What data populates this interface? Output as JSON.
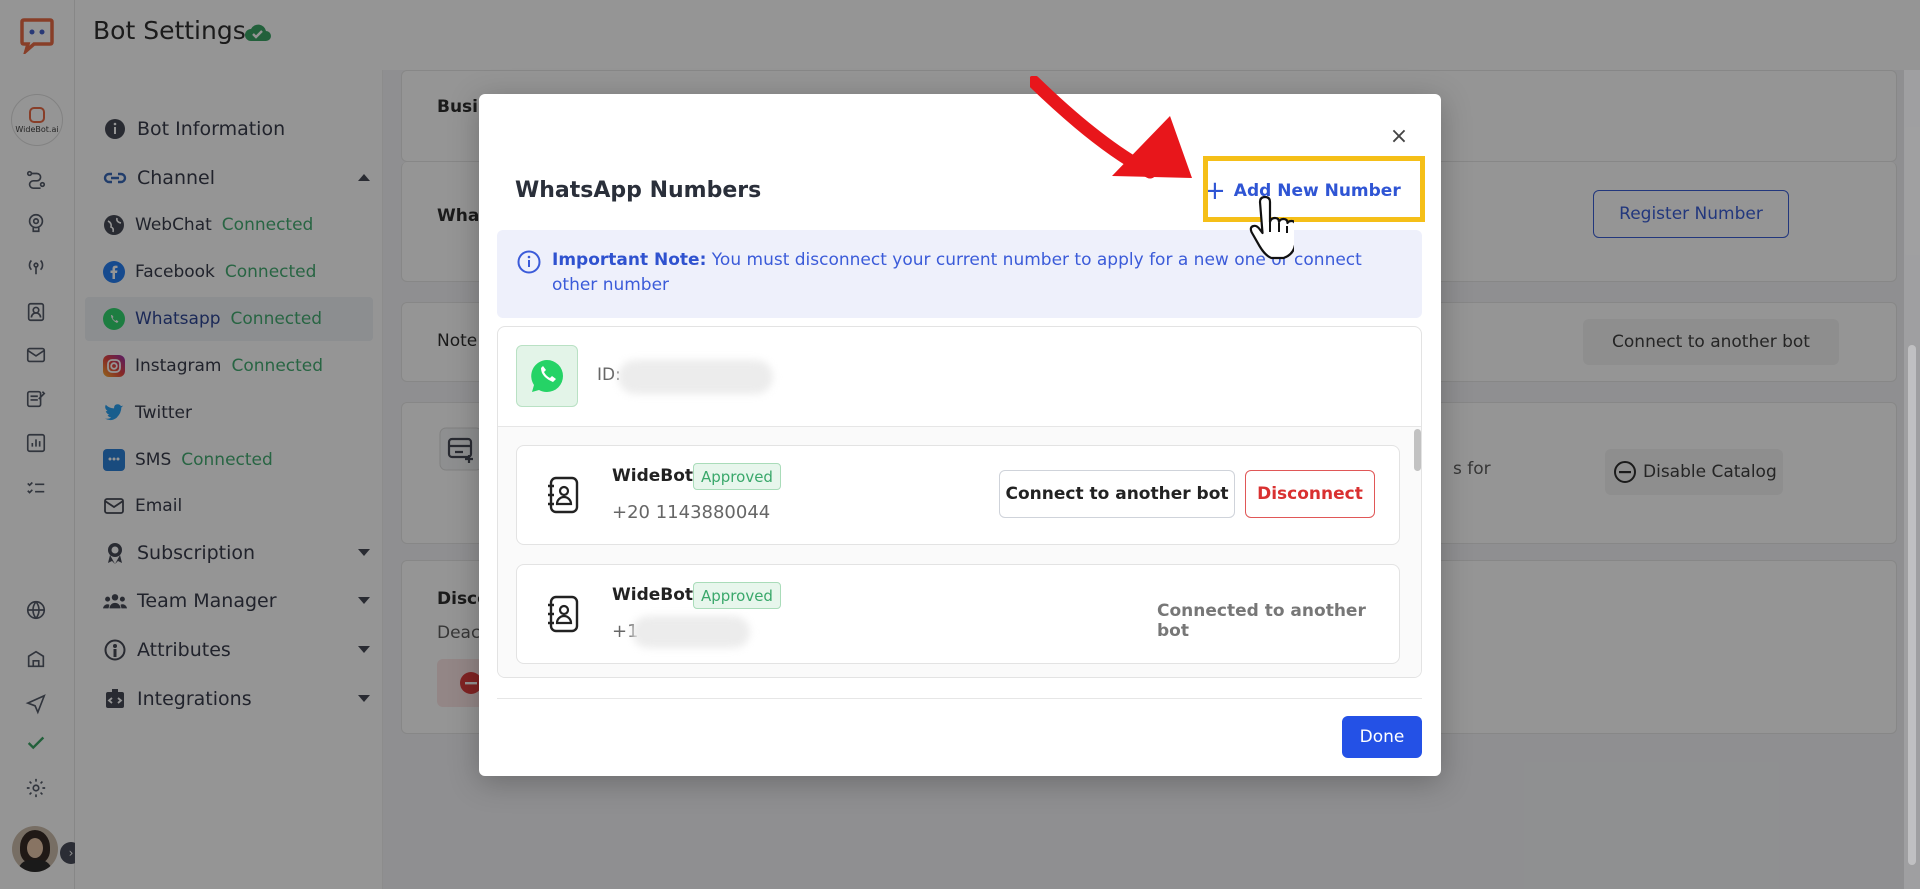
{
  "header": {
    "title": "Bot Settings"
  },
  "rail": {
    "workspace_label": "WideBot.ai"
  },
  "nav": {
    "bot_information": "Bot Information",
    "channel": "Channel",
    "channels": [
      {
        "label": "WebChat",
        "status": "Connected"
      },
      {
        "label": "Facebook",
        "status": "Connected"
      },
      {
        "label": "Whatsapp",
        "status": "Connected"
      },
      {
        "label": "Instagram",
        "status": "Connected"
      },
      {
        "label": "Twitter",
        "status": ""
      },
      {
        "label": "SMS",
        "status": "Connected"
      },
      {
        "label": "Email",
        "status": ""
      }
    ],
    "subscription": "Subscription",
    "team_manager": "Team Manager",
    "attributes": "Attributes",
    "integrations": "Integrations"
  },
  "background": {
    "business_label": "Busines",
    "whatsapp_label": "WhatsA",
    "register_number": "Register Number",
    "note_label": "Note: Yo",
    "connect_to_another_bot": "Connect to another bot",
    "catalog_text": "s for",
    "disable_catalog": "Disable Catalog",
    "disconnect_label": "Disconn",
    "deactivate_label": "Deactiv"
  },
  "modal": {
    "title": "WhatsApp Numbers",
    "add_new_number": "Add New Number",
    "close": "×",
    "note_title": "Important Note:",
    "note_text": "You must disconnect your current number to apply for a new one or connect other number",
    "id_label": "ID:",
    "accounts": [
      {
        "name": "WideBot",
        "badge": "Approved",
        "phone": "+20 1143880044",
        "connect_label": "Connect to another bot",
        "disconnect_label": "Disconnect"
      },
      {
        "name": "WideBot",
        "badge": "Approved",
        "phone": "+1",
        "status_text": "Connected to another bot"
      }
    ],
    "done": "Done"
  },
  "colors": {
    "accent": "#2451e6",
    "connected": "#3aa86b",
    "danger": "#d93131",
    "highlight": "#f5bf18",
    "annotation_arrow": "#e8161b"
  }
}
